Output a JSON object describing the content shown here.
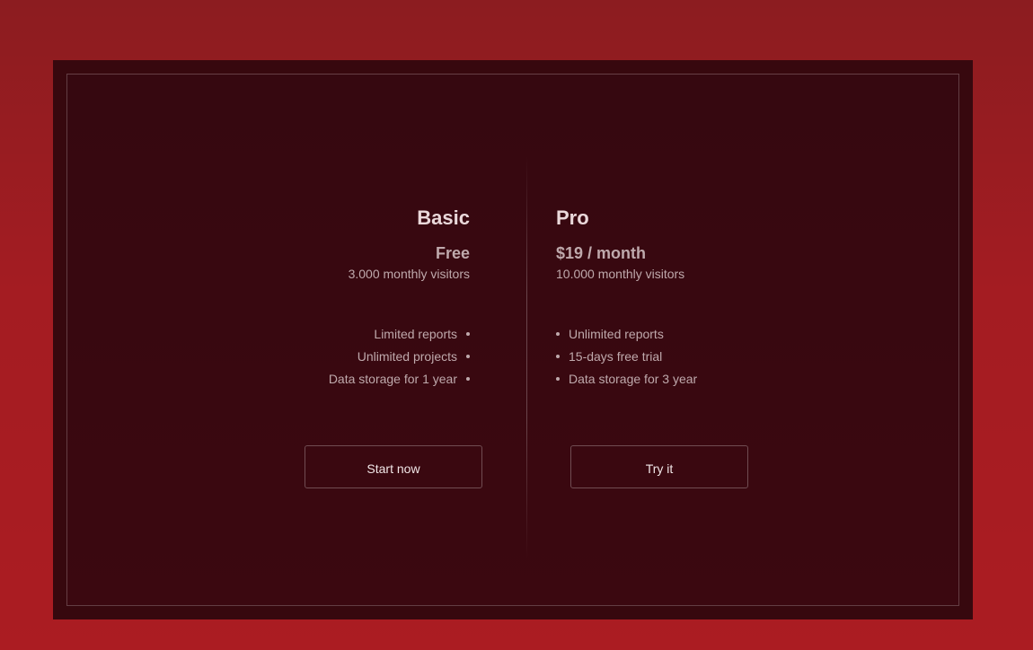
{
  "plans": [
    {
      "title": "Basic",
      "price": "Free",
      "visitors": "3.000 monthly visitors",
      "features": [
        "Limited reports",
        "Unlimited projects",
        "Data storage for 1 year"
      ],
      "cta": "Start now"
    },
    {
      "title": "Pro",
      "price": "$19 / month",
      "visitors": "10.000 monthly visitors",
      "features": [
        "Unlimited reports",
        "15-days free trial",
        "Data storage for 3 year"
      ],
      "cta": "Try it"
    }
  ],
  "colors": {
    "background": "#a41c22",
    "panel": "#37080e",
    "text_primary": "#ead8da",
    "text_secondary": "#bfa9ac"
  }
}
